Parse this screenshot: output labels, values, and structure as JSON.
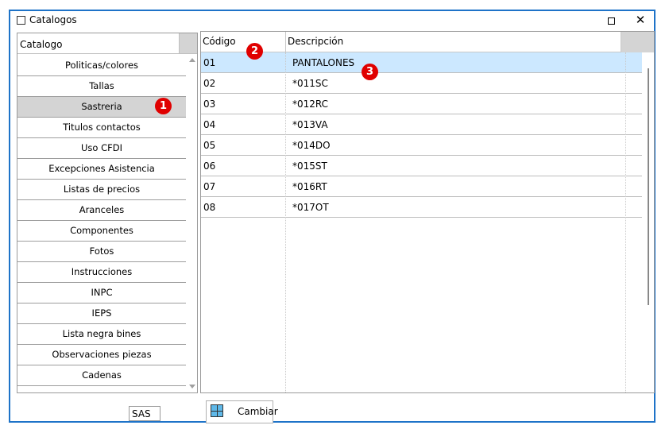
{
  "window": {
    "title": "Catalogos"
  },
  "catalog_panel": {
    "header": "Catalogo",
    "items": [
      {
        "label": "Politicas/colores",
        "selected": false
      },
      {
        "label": "Tallas",
        "selected": false
      },
      {
        "label": "Sastreria",
        "selected": true
      },
      {
        "label": "Titulos contactos",
        "selected": false
      },
      {
        "label": "Uso CFDI",
        "selected": false
      },
      {
        "label": "Excepciones Asistencia",
        "selected": false
      },
      {
        "label": "Listas de precios",
        "selected": false
      },
      {
        "label": "Aranceles",
        "selected": false
      },
      {
        "label": "Componentes",
        "selected": false
      },
      {
        "label": "Fotos",
        "selected": false
      },
      {
        "label": "Instrucciones",
        "selected": false
      },
      {
        "label": "INPC",
        "selected": false
      },
      {
        "label": "IEPS",
        "selected": false
      },
      {
        "label": "Lista negra bines",
        "selected": false
      },
      {
        "label": "Observaciones piezas",
        "selected": false
      },
      {
        "label": "Cadenas",
        "selected": false
      }
    ]
  },
  "grid": {
    "columns": [
      "Código",
      "Descripción"
    ],
    "rows": [
      {
        "code": "01",
        "desc": "PANTALONES",
        "selected": true
      },
      {
        "code": "02",
        "desc": "*011SC",
        "selected": false
      },
      {
        "code": "03",
        "desc": "*012RC",
        "selected": false
      },
      {
        "code": "04",
        "desc": "*013VA",
        "selected": false
      },
      {
        "code": "05",
        "desc": "*014DO",
        "selected": false
      },
      {
        "code": "06",
        "desc": "*015ST",
        "selected": false
      },
      {
        "code": "07",
        "desc": "*016RT",
        "selected": false
      },
      {
        "code": "08",
        "desc": "*017OT",
        "selected": false
      }
    ]
  },
  "footer": {
    "company_code": "SAS",
    "change_button": "Cambiar"
  },
  "markers": [
    "1",
    "2",
    "3"
  ],
  "colors": {
    "window_border": "#1e73c8",
    "selected_row": "#cce8ff",
    "selected_catalog": "#d4d4d4",
    "marker": "#e00000"
  }
}
